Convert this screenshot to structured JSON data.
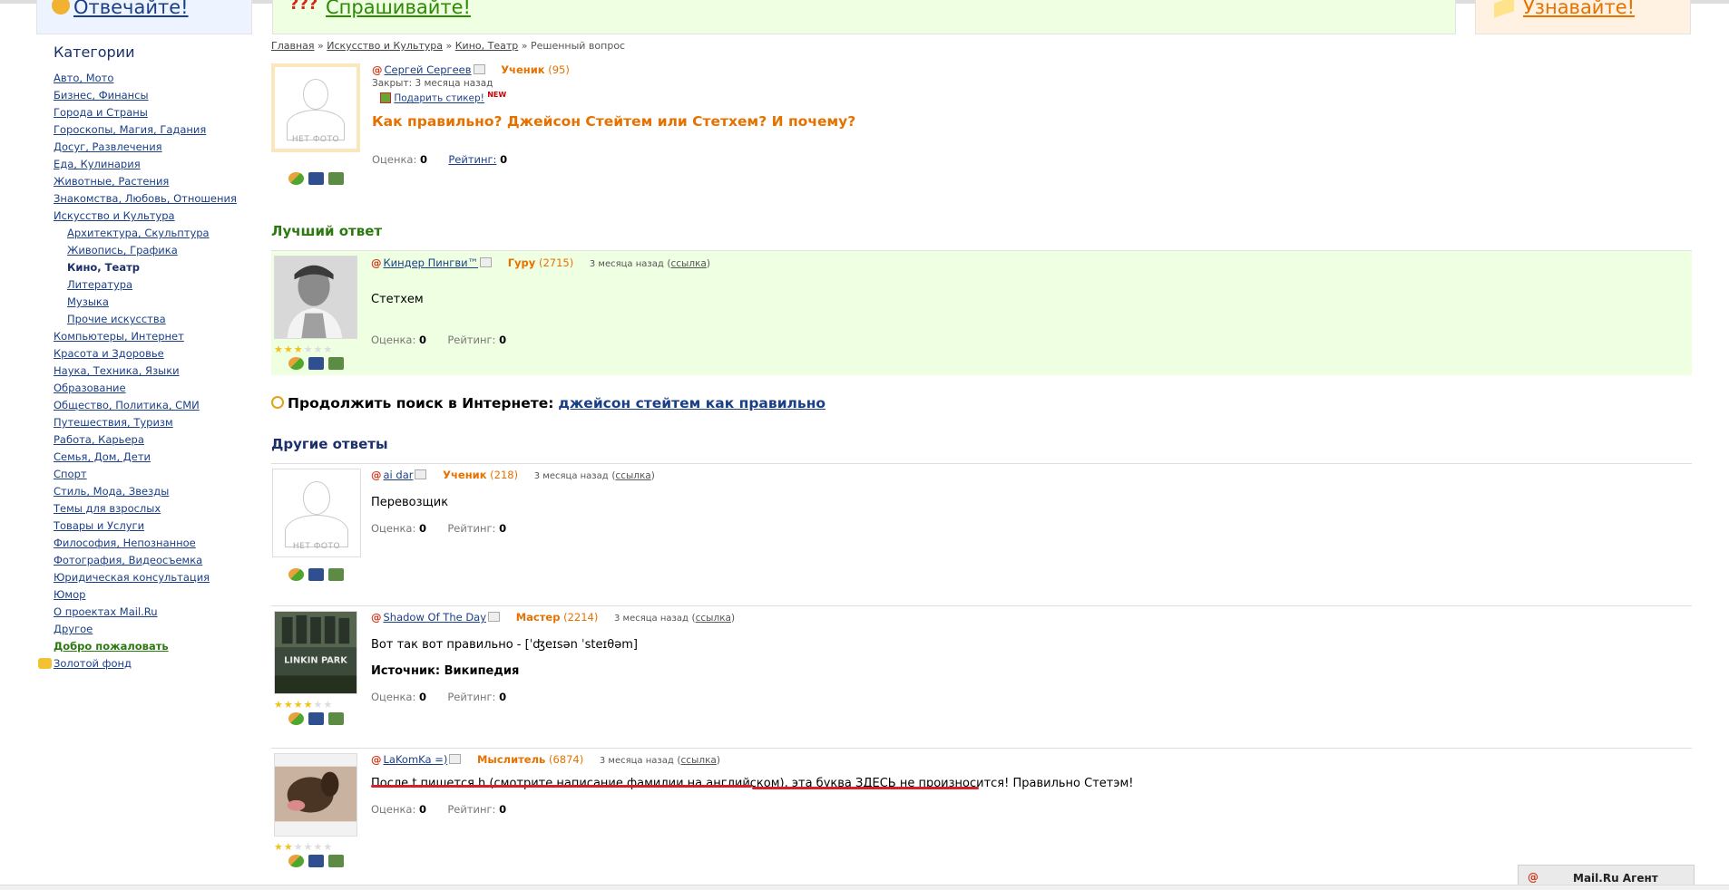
{
  "banner": {
    "answer": "Отвечайте!",
    "ask": "Спрашивайте!",
    "learn": "Узнавайте!"
  },
  "sidebar": {
    "title": "Категории",
    "items": [
      {
        "label": "Авто, Мото"
      },
      {
        "label": "Бизнес, Финансы"
      },
      {
        "label": "Города и Страны"
      },
      {
        "label": "Гороскопы, Магия, Гадания"
      },
      {
        "label": "Досуг, Развлечения"
      },
      {
        "label": "Еда, Кулинария"
      },
      {
        "label": "Животные, Растения"
      },
      {
        "label": "Знакомства, Любовь, Отношения"
      },
      {
        "label": "Искусство и Культура"
      },
      {
        "label": "Архитектура, Скульптура"
      },
      {
        "label": "Живопись, Графика"
      },
      {
        "label": "Кино, Театр"
      },
      {
        "label": "Литература"
      },
      {
        "label": "Музыка"
      },
      {
        "label": "Прочие искусства"
      },
      {
        "label": "Компьютеры, Интернет"
      },
      {
        "label": "Красота и Здоровье"
      },
      {
        "label": "Наука, Техника, Языки"
      },
      {
        "label": "Образование"
      },
      {
        "label": "Общество, Политика, СМИ"
      },
      {
        "label": "Путешествия, Туризм"
      },
      {
        "label": "Работа, Карьера"
      },
      {
        "label": "Семья, Дом, Дети"
      },
      {
        "label": "Спорт"
      },
      {
        "label": "Стиль, Мода, Звезды"
      },
      {
        "label": "Темы для взрослых"
      },
      {
        "label": "Товары и Услуги"
      },
      {
        "label": "Философия, Непознанное"
      },
      {
        "label": "Фотография, Видеосъемка"
      },
      {
        "label": "Юридическая консультация"
      },
      {
        "label": "Юмор"
      },
      {
        "label": "О проектах Mail.Ru"
      },
      {
        "label": "Другое"
      },
      {
        "label": "Добро пожаловать"
      },
      {
        "label": "Золотой фонд"
      }
    ]
  },
  "breadcrumb": {
    "home": "Главная",
    "sep": "»",
    "cat": "Искусство и Культура",
    "sub": "Кино, Театр",
    "current": "Решенный вопрос"
  },
  "question": {
    "author": "Сергей Сергеев",
    "rank": "Ученик",
    "points": "(95)",
    "closed": "Закрыт: 3 месяца назад",
    "gift": "Подарить стикер!",
    "new_badge": "NEW",
    "title": "Как правильно? Джейсон Стейтем или Стетхем? И почему?",
    "score_label": "Оценка:",
    "score": "0",
    "rating_label": "Рейтинг:",
    "rating": "0",
    "no_photo": "НЕТ ФОТО"
  },
  "best_answer": {
    "section_title": "Лучший ответ",
    "author": "Киндер Пингви™",
    "rank": "Гуру",
    "points": "(2715)",
    "when": "3 месяца назад",
    "link": "ссылка",
    "text": "Стетхем",
    "score_label": "Оценка:",
    "score": "0",
    "rating_label": "Рейтинг:",
    "rating": "0",
    "stars": 3
  },
  "continue_search": {
    "label": "Продолжить поиск в Интернете:",
    "query": "джейсон стейтем как правильно"
  },
  "other_answers": {
    "section_title": "Другие ответы",
    "items": [
      {
        "author": "ai dar",
        "rank": "Ученик",
        "points": "(218)",
        "when": "3 месяца назад",
        "link": "ссылка",
        "text": "Перевозщик",
        "score_label": "Оценка:",
        "score": "0",
        "rating_label": "Рейтинг:",
        "rating": "0",
        "no_photo": "НЕТ ФОТО"
      },
      {
        "author": "Shadow Of The Day",
        "rank": "Мастер",
        "points": "(2214)",
        "when": "3 месяца назад",
        "link": "ссылка",
        "text": "Вот так вот правильно - [ˈʤeɪsən ˈsteɪθəm]",
        "source_label": "Источник: Википедия",
        "score_label": "Оценка:",
        "score": "0",
        "rating_label": "Рейтинг:",
        "rating": "0",
        "stars": 4,
        "photo_caption": "LINKIN PARK"
      },
      {
        "author": "LaKomKa =)",
        "rank": "Мыслитель",
        "points": "(6874)",
        "when": "3 месяца назад",
        "link": "ссылка",
        "text": "После t пишется h (смотрите написание фамилии на английском), эта буква ЗДЕСЬ не произносится! Правильно Стетэм!",
        "score_label": "Оценка:",
        "score": "0",
        "rating_label": "Рейтинг:",
        "rating": "0",
        "stars": 2
      }
    ]
  },
  "agent": {
    "label": "Mail.Ru Агент"
  },
  "colors": {
    "link": "#1b3f86",
    "orange": "#e57200",
    "green": "#2b7a10",
    "best_bg": "#eeffe2",
    "underline_red": "#d8202a"
  }
}
